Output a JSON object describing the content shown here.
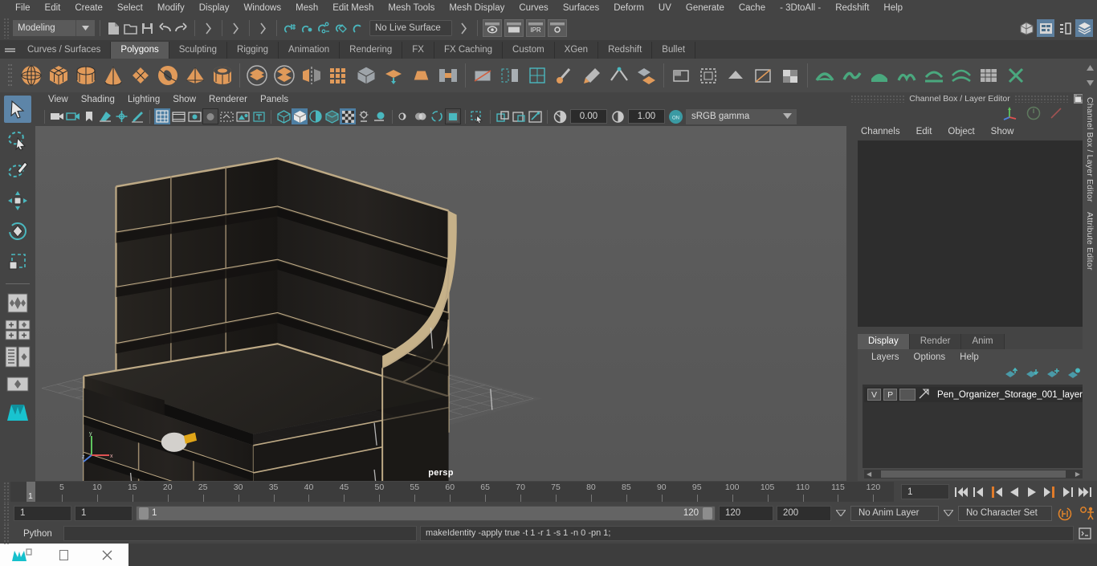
{
  "menubar": {
    "items": [
      "File",
      "Edit",
      "Create",
      "Select",
      "Modify",
      "Display",
      "Windows",
      "Mesh",
      "Edit Mesh",
      "Mesh Tools",
      "Mesh Display",
      "Curves",
      "Surfaces",
      "Deform",
      "UV",
      "Generate",
      "Cache",
      "- 3DtoAll -",
      "Redshift",
      "Help"
    ]
  },
  "statusline": {
    "menuset": "Modeling",
    "live_surface": "No Live Surface",
    "ipr_label": "IPR"
  },
  "shelf": {
    "tabs": [
      "Curves / Surfaces",
      "Polygons",
      "Sculpting",
      "Rigging",
      "Animation",
      "Rendering",
      "FX",
      "FX Caching",
      "Custom",
      "XGen",
      "Redshift",
      "Bullet"
    ],
    "active_tab": "Polygons"
  },
  "viewport": {
    "menu": [
      "View",
      "Shading",
      "Lighting",
      "Show",
      "Renderer",
      "Panels"
    ],
    "exposure": "0.00",
    "gamma": "1.00",
    "color_profile": "sRGB gamma",
    "camera_label": "persp",
    "axis": {
      "x": "x",
      "y": "y",
      "z": "z"
    }
  },
  "channel_box": {
    "title": "Channel Box / Layer Editor",
    "menu": [
      "Channels",
      "Edit",
      "Object",
      "Show"
    ],
    "side_tabs": [
      "Channel Box / Layer Editor",
      "Attribute Editor"
    ]
  },
  "layer_editor": {
    "tabs": [
      "Display",
      "Render",
      "Anim"
    ],
    "active_tab": "Display",
    "menu": [
      "Layers",
      "Options",
      "Help"
    ],
    "layers": [
      {
        "visible": "V",
        "playback": "P",
        "color": "",
        "name": "Pen_Organizer_Storage_001_layer"
      }
    ]
  },
  "timeline": {
    "ticks": [
      5,
      10,
      15,
      20,
      25,
      30,
      35,
      40,
      45,
      50,
      55,
      60,
      65,
      70,
      75,
      80,
      85,
      90,
      95,
      100,
      105,
      110,
      115,
      120
    ],
    "current_frame": "1",
    "current_frame_field": "1"
  },
  "range": {
    "start": "1",
    "end": "1",
    "range_start_label": "1",
    "range_end_label": "120",
    "playback_end": "120",
    "animation_end": "200",
    "anim_layer": "No Anim Layer",
    "character_set": "No Character Set"
  },
  "command": {
    "language": "Python",
    "input_value": "",
    "result": "makeIdentity -apply true -t 1 -r 1 -s 1 -n 0 -pn 1;"
  },
  "colors": {
    "accent_blue": "#5d85a8",
    "teal": "#4ab8bf",
    "shelf_orange": "#e09a5a",
    "panel_bg": "#444444",
    "viewport_bg": "#5b5b5b"
  }
}
